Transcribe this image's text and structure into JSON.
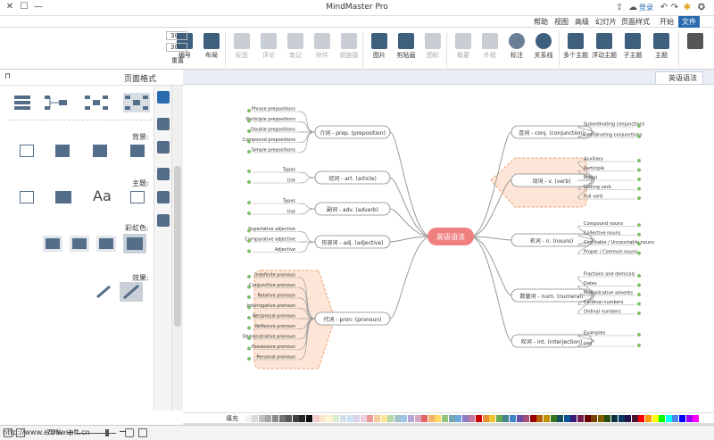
{
  "app": {
    "title": "MindMaster Pro",
    "window_controls": [
      "minimize",
      "maximize",
      "close"
    ],
    "quick_access_label": "登录"
  },
  "ribbon_tabs": [
    {
      "label": "文件",
      "active": true
    },
    {
      "label": "开始",
      "active": false
    },
    {
      "label": "页面样式",
      "active": false
    },
    {
      "label": "幻灯片",
      "active": false
    },
    {
      "label": "高级",
      "active": false
    },
    {
      "label": "视图",
      "active": false
    },
    {
      "label": "帮助",
      "active": false
    }
  ],
  "ribbon_buttons": [
    {
      "label": "主题",
      "icon": "theme-icon",
      "dim": false
    },
    {
      "label": "子主题",
      "icon": "subtopic-icon",
      "dim": false
    },
    {
      "label": "浮动主题",
      "icon": "floating-topic-icon",
      "dim": false
    },
    {
      "label": "多个主题",
      "icon": "multiple-topics-icon",
      "dim": false
    },
    {
      "label": "关系线",
      "icon": "relationship-icon",
      "dim": false
    },
    {
      "label": "标注",
      "icon": "callout-icon",
      "dim": false
    },
    {
      "label": "外框",
      "icon": "boundary-icon",
      "dim": true
    },
    {
      "label": "概要",
      "icon": "summary-icon",
      "dim": true
    },
    {
      "label": "图标",
      "icon": "mark-icon",
      "dim": true
    },
    {
      "label": "剪贴画",
      "icon": "clipart-icon",
      "dim": false
    },
    {
      "label": "图片",
      "icon": "image-icon",
      "dim": false
    },
    {
      "label": "超链接",
      "icon": "hyperlink-icon",
      "dim": true
    },
    {
      "label": "附件",
      "icon": "attachment-icon",
      "dim": true
    },
    {
      "label": "笔记",
      "icon": "note-icon",
      "dim": true
    },
    {
      "label": "评论",
      "icon": "comment-icon",
      "dim": true
    },
    {
      "label": "标签",
      "icon": "tag-icon",
      "dim": true
    },
    {
      "label": "布局",
      "icon": "layout-icon",
      "dim": false
    },
    {
      "label": "编号",
      "icon": "numbering-icon",
      "dim": false
    },
    {
      "label": "重置",
      "icon": "reset-icon",
      "dim": false
    }
  ],
  "spinner_values": [
    "30",
    "30"
  ],
  "left_panel": {
    "title": "页面格式",
    "sections": [
      {
        "label": "背景:"
      },
      {
        "label": "主题:"
      },
      {
        "label": "彩虹色:"
      },
      {
        "label": "效果:"
      }
    ],
    "theme_font_sample": "Aa"
  },
  "canvas_tab": {
    "label": "英语语法"
  },
  "mindmap": {
    "central": "英语语法",
    "left_branches": [
      {
        "label": "介词 - prep. (preposition)",
        "children": [
          "Phrase prepositions",
          "Participle prepositions",
          "Double prepositions",
          "Compound prepositions",
          "Simple prepositions"
        ]
      },
      {
        "label": "冠词 - art. (article)",
        "children": [
          "Types",
          "Use"
        ]
      },
      {
        "label": "副词 - adv. (adverb)",
        "children": [
          "Types",
          "Use"
        ]
      },
      {
        "label": "形容词 - adj. (adjective)",
        "children": [
          "Superlative adjective",
          "Comparative adjective",
          "Adjective"
        ]
      },
      {
        "label": "代词 - pron. (pronoun)",
        "children": [
          "Indefinite pronoun",
          "Conjunctive pronoun",
          "Relative pronoun",
          "Interrogative pronoun",
          "Reciprocal pronoun",
          "Reflexive pronoun",
          "Demonstrative pronoun",
          "Possessive pronoun",
          "Personal pronoun"
        ]
      }
    ],
    "right_branches": [
      {
        "label": "连词 - conj. (conjunction)",
        "children": [
          "Subordinating conjunctions",
          "Coordinating conjunctions"
        ]
      },
      {
        "label": "动词 - v. (verb)",
        "children": [
          "Auxiliary",
          "Participle",
          "Modal",
          "Linking verb",
          "Full verb"
        ]
      },
      {
        "label": "名词 - n. (nouns)",
        "children": [
          "Compound nouns",
          "Collective nouns",
          "Countable / Uncountable nouns",
          "Proper / Common nouns"
        ]
      },
      {
        "label": "数量词 - num. (numeral)",
        "children": [
          "Fractions and demicals",
          "Dates",
          "Multiplicative adverbs",
          "Cardinal numbers",
          "Ordinal numbers"
        ]
      },
      {
        "label": "叹词 - int. (interjection)",
        "children": [
          "Examples",
          "Use"
        ]
      }
    ]
  },
  "color_bar": {
    "label": "填充"
  },
  "status": {
    "url": "http://www.edrawsoft.cn",
    "zoom": "70%"
  },
  "colors": {
    "accent": "#2a6bb0",
    "central_topic": "#f08080",
    "highlight_fill": "#fde6d8",
    "highlight_border": "#f0a070",
    "connector": "#999999",
    "expander": "#7cc06a"
  }
}
